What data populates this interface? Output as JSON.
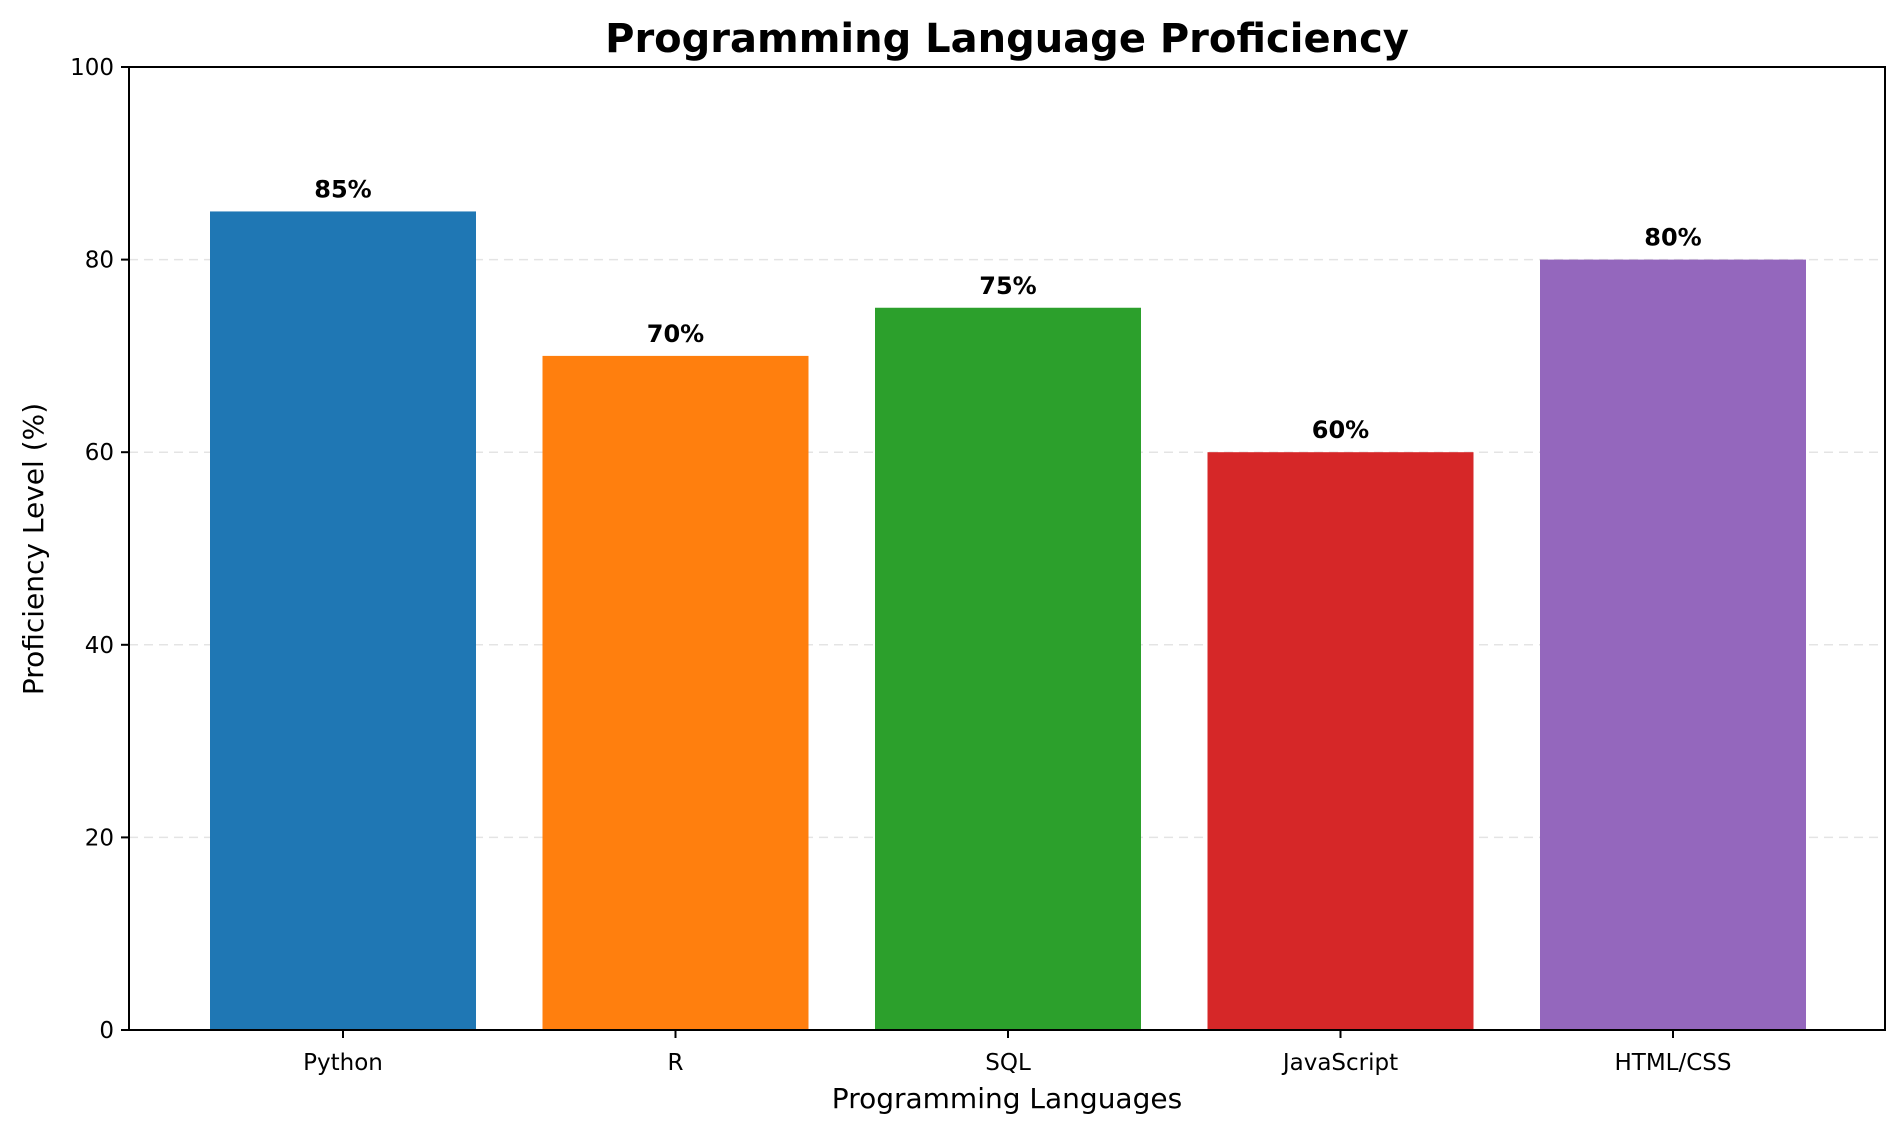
{
  "chart_data": {
    "type": "bar",
    "title": "Programming Language Proficiency",
    "xlabel": "Programming Languages",
    "ylabel": "Proficiency Level (%)",
    "categories": [
      "Python",
      "R",
      "SQL",
      "JavaScript",
      "HTML/CSS"
    ],
    "values": [
      85,
      70,
      75,
      60,
      80
    ],
    "value_labels": [
      "85%",
      "70%",
      "75%",
      "60%",
      "80%"
    ],
    "colors": [
      "#1f77b4",
      "#ff7f0e",
      "#2ca02c",
      "#d62728",
      "#9467bd"
    ],
    "ylim": [
      0,
      100
    ],
    "yticks": [
      0,
      20,
      40,
      60,
      80,
      100
    ],
    "ytick_labels": [
      "0",
      "20",
      "40",
      "60",
      "80",
      "100"
    ],
    "grid": "y-axis dashed",
    "legend": "none"
  }
}
